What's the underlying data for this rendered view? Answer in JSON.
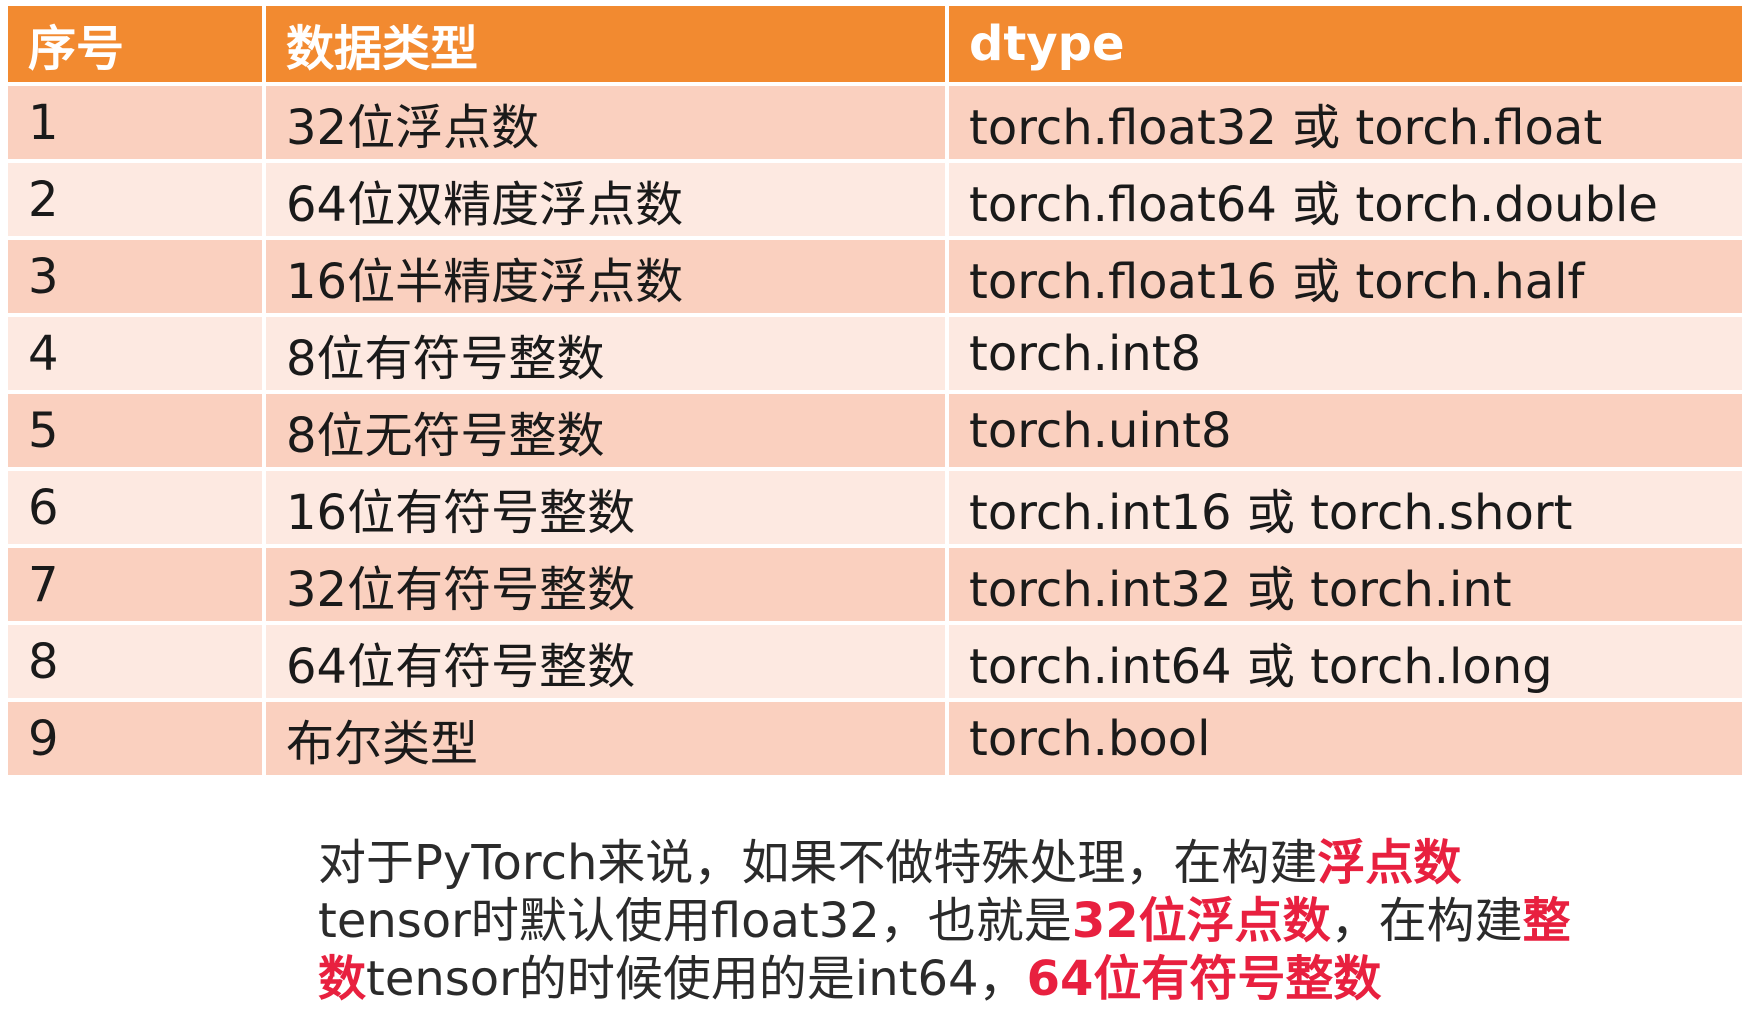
{
  "table": {
    "headers": [
      "序号",
      "数据类型",
      "dtype"
    ],
    "rows": [
      [
        "1",
        "32位浮点数",
        "torch.float32 或 torch.float"
      ],
      [
        "2",
        "64位双精度浮点数",
        "torch.float64 或 torch.double"
      ],
      [
        "3",
        "16位半精度浮点数",
        "torch.float16 或 torch.half"
      ],
      [
        "4",
        "8位有符号整数",
        "torch.int8"
      ],
      [
        "5",
        "8位无符号整数",
        "torch.uint8"
      ],
      [
        "6",
        "16位有符号整数",
        "torch.int16 或 torch.short"
      ],
      [
        "7",
        "32位有符号整数",
        "torch.int32 或 torch.int"
      ],
      [
        "8",
        "64位有符号整数",
        "torch.int64 或 torch.long"
      ],
      [
        "9",
        "布尔类型",
        "torch.bool"
      ]
    ]
  },
  "note": {
    "segments": [
      {
        "text": "对于PyTorch来说，如果不做特殊处理，在构建",
        "highlight": false
      },
      {
        "text": "浮点数",
        "highlight": true
      },
      {
        "text": "tensor时默认使用float32，也就是",
        "highlight": false
      },
      {
        "text": "32位浮点数",
        "highlight": true
      },
      {
        "text": "，在构建",
        "highlight": false
      },
      {
        "text": "整数",
        "highlight": true
      },
      {
        "text": "tensor的时候使用的是int64，",
        "highlight": false
      },
      {
        "text": "64位有符号整数",
        "highlight": true
      }
    ]
  },
  "colors": {
    "header_bg": "#f28a30",
    "row_odd_bg": "#fad0bf",
    "row_even_bg": "#fde9e1",
    "highlight_text": "#e8203f"
  }
}
